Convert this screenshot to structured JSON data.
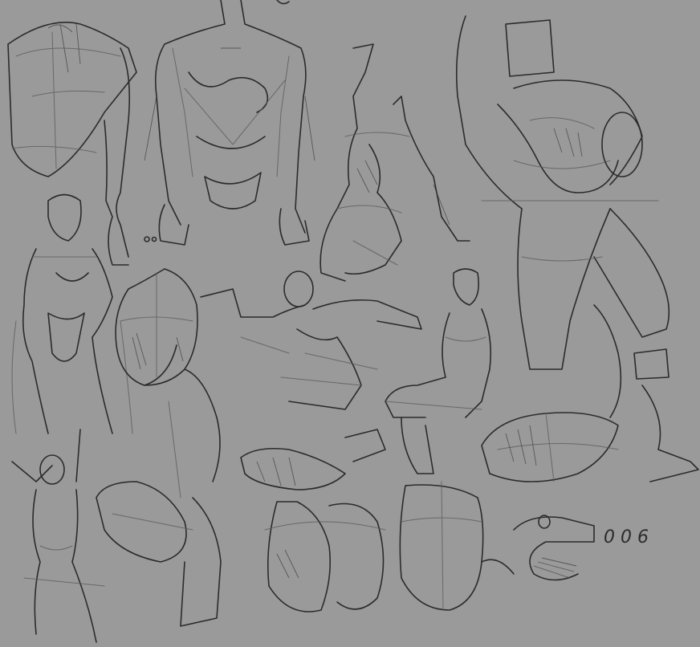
{
  "canvas": {
    "background": "#9a9a9a",
    "ink": "#2b2b2b"
  },
  "annotation": {
    "text": "0 0 6"
  }
}
